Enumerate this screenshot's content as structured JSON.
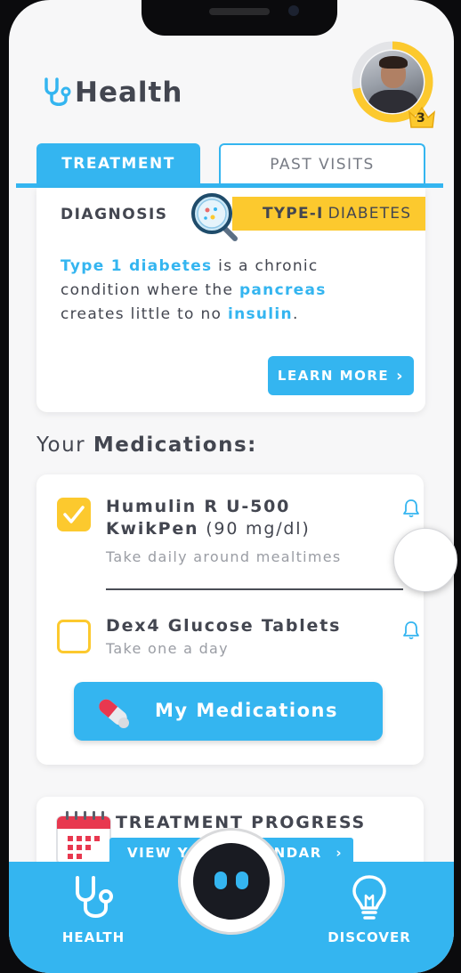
{
  "app": {
    "logo_text": "Health"
  },
  "user": {
    "level": "3",
    "ring_progress": 0.72,
    "ring_color": "#fcc92e"
  },
  "colors": {
    "accent": "#34b5f0",
    "highlight": "#fcc92e",
    "text": "#434650"
  },
  "tabs": [
    {
      "label": "TREATMENT",
      "active": true
    },
    {
      "label": "PAST VISITS",
      "active": false
    }
  ],
  "diagnosis": {
    "label": "DIAGNOSIS",
    "type_bold": "TYPE-I",
    "type_rest": "DIABETES",
    "desc": {
      "term1": "Type 1 diabetes",
      "text1": " is a chronic condition where the ",
      "term2": "pancreas",
      "text2": " creates little to no ",
      "term3": "insulin",
      "text3": "."
    },
    "learn_more": "LEARN MORE",
    "learn_more_chevron": "›"
  },
  "medications": {
    "heading_prefix": "Your ",
    "heading_bold": "Medications:",
    "items": [
      {
        "name_line1": "Humulin R U-500",
        "name_line2": "KwikPen",
        "dose": " (90 mg/dl)",
        "instructions": "Take daily around mealtimes",
        "checked": true
      },
      {
        "name_line1": "Dex4 Glucose Tablets",
        "instructions": "Take one a day",
        "checked": false
      }
    ],
    "button_label": "My Medications"
  },
  "progress": {
    "title": "TREATMENT PROGRESS",
    "button_label": "VIEW YOUR CALENDAR",
    "chevron": "›"
  },
  "bottom_nav": {
    "health": "HEALTH",
    "discover": "DISCOVER"
  }
}
